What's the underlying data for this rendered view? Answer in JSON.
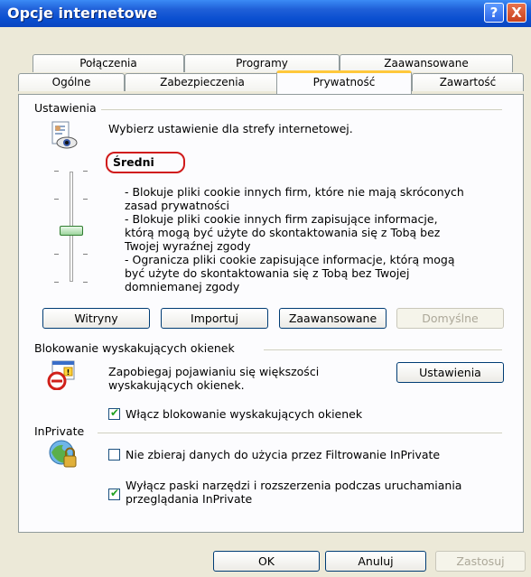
{
  "window": {
    "title": "Opcje internetowe"
  },
  "titlebar_buttons": {
    "help": "?",
    "close": "X"
  },
  "tabs_row1": [
    "Połączenia",
    "Programy",
    "Zaawansowane"
  ],
  "tabs_row2": [
    "Ogólne",
    "Zabezpieczenia",
    "Prywatność",
    "Zawartość"
  ],
  "active_tab": "Prywatność",
  "settings": {
    "group_label": "Ustawienia",
    "instruction": "Wybierz ustawienie dla strefy internetowej.",
    "level": "Średni",
    "description_lines": [
      "- Blokuje pliki cookie innych firm, które nie mają skróconych",
      "zasad prywatności",
      "- Blokuje pliki cookie innych firm zapisujące informacje,",
      "którą mogą być użyte do skontaktowania się z Tobą bez",
      "Twojej wyraźnej zgody",
      "- Ogranicza pliki cookie zapisujące informacje, którą mogą",
      "być użyte do skontaktowania się z Tobą bez Twojej",
      "domniemanej zgody"
    ],
    "buttons": {
      "sites": "Witryny",
      "import": "Importuj",
      "advanced": "Zaawansowane",
      "default": "Domyślne"
    }
  },
  "popup": {
    "group_label": "Blokowanie wyskakujących okienek",
    "text_line1": "Zapobiegaj pojawianiu się większości",
    "text_line2": "wyskakujących okienek.",
    "settings_button": "Ustawienia",
    "checkbox_label": "Włącz blokowanie wyskakujących okienek",
    "checkbox_checked": true
  },
  "inprivate": {
    "group_label": "InPrivate",
    "filter_label": "Nie zbieraj danych do użycia przez Filtrowanie InPrivate",
    "filter_checked": false,
    "toolbars_line1": "Wyłącz paski narzędzi i rozszerzenia podczas uruchamiania",
    "toolbars_line2": "przeglądania InPrivate",
    "toolbars_checked": true
  },
  "dialog_buttons": {
    "ok": "OK",
    "cancel": "Anuluj",
    "apply": "Zastosuj"
  },
  "colors": {
    "titlebar": "#0A4FD0",
    "active_tab_accent": "#FFC83C",
    "highlight_outline": "#D01A1A"
  }
}
